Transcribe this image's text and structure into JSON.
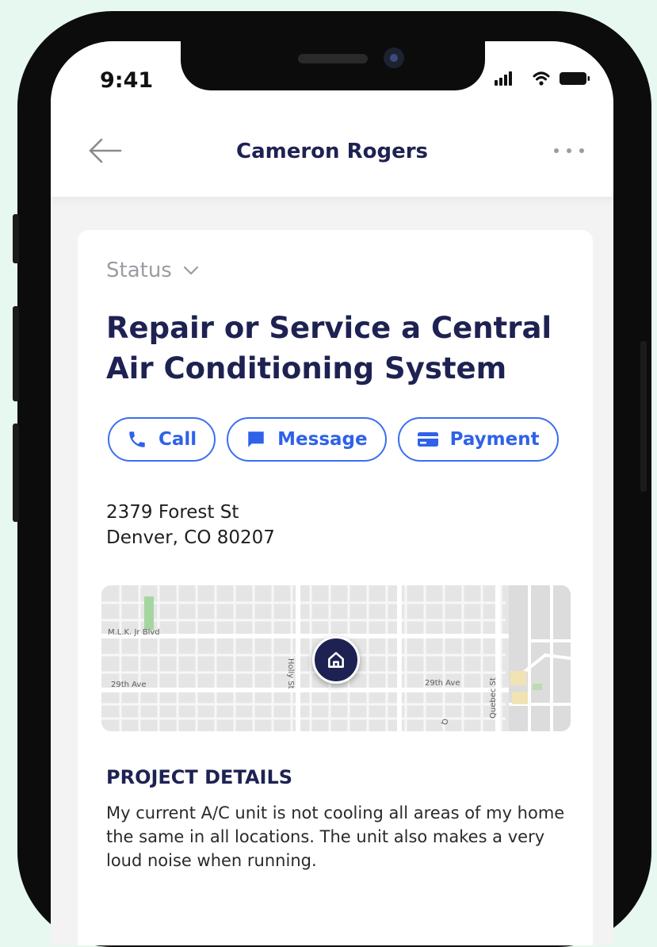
{
  "status_bar": {
    "time": "9:41"
  },
  "header": {
    "title": "Cameron Rogers",
    "back_icon": "arrow-left-icon",
    "more_icon": "more-horizontal-icon"
  },
  "card": {
    "status_label": "Status",
    "title": "Repair or Service a Central Air Conditioning System",
    "actions": [
      {
        "label": "Call",
        "icon": "phone-icon"
      },
      {
        "label": "Message",
        "icon": "chat-icon"
      },
      {
        "label": "Payment",
        "icon": "credit-card-icon"
      }
    ],
    "address_line1": "2379 Forest St",
    "address_line2": "Denver, CO 80207",
    "map": {
      "street_labels": [
        "M.L.K. Jr Blvd",
        "29th Ave",
        "Holly St",
        "29th Ave",
        "Quebec St",
        "Q"
      ],
      "pin_icon": "home-icon"
    },
    "details_heading": "PROJECT DETAILS",
    "details_text": "My current A/C unit is not cooling all areas of my home the same in all locations. The unit also makes a very loud noise when running."
  },
  "colors": {
    "accent": "#3b6ef2",
    "navy": "#1e2252",
    "background": "#e6f8ef"
  }
}
